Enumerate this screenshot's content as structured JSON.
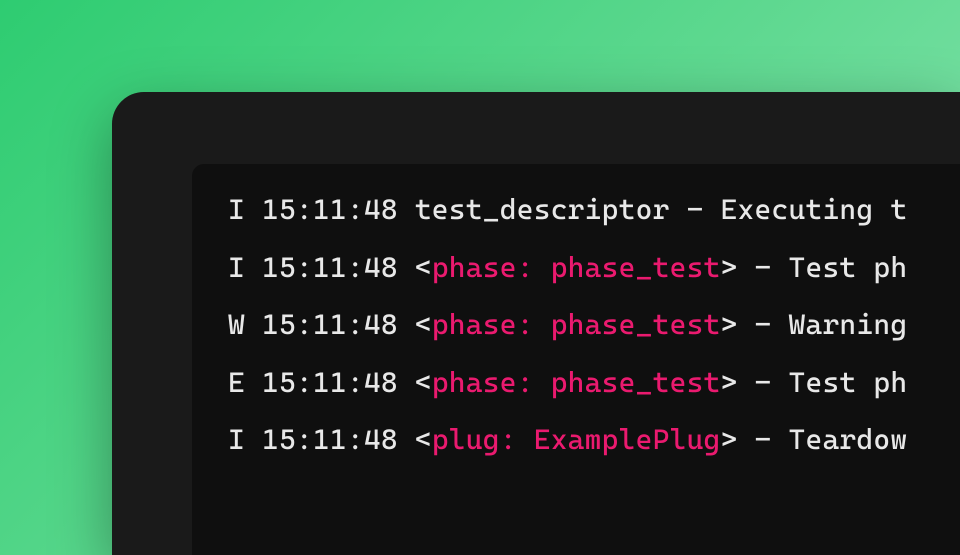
{
  "colors": {
    "bg_gradient_start": "#2ecc71",
    "bg_gradient_end": "#8ee6b5",
    "window_bg": "#1a1a1a",
    "terminal_bg": "#0f0f0f",
    "text": "#e8e8e8",
    "highlight": "#ea1a6f"
  },
  "log": {
    "lines": [
      {
        "level": "I",
        "timestamp": "15:11:48",
        "source_plain": "test_descriptor",
        "separator": "-",
        "message": "Executing t"
      },
      {
        "level": "I",
        "timestamp": "15:11:48",
        "source_tag": {
          "open": "<",
          "key": "phase",
          "colon": ": ",
          "value": "phase_test",
          "close": ">"
        },
        "separator": "-",
        "message": "Test ph"
      },
      {
        "level": "W",
        "timestamp": "15:11:48",
        "source_tag": {
          "open": "<",
          "key": "phase",
          "colon": ": ",
          "value": "phase_test",
          "close": ">"
        },
        "separator": "-",
        "message": "Warning"
      },
      {
        "level": "E",
        "timestamp": "15:11:48",
        "source_tag": {
          "open": "<",
          "key": "phase",
          "colon": ": ",
          "value": "phase_test",
          "close": ">"
        },
        "separator": "-",
        "message": "Test ph"
      },
      {
        "level": "I",
        "timestamp": "15:11:48",
        "source_tag": {
          "open": "<",
          "key": "plug",
          "colon": ": ",
          "value": "ExamplePlug",
          "close": ">"
        },
        "separator": "-",
        "message": "Teardow"
      }
    ]
  }
}
